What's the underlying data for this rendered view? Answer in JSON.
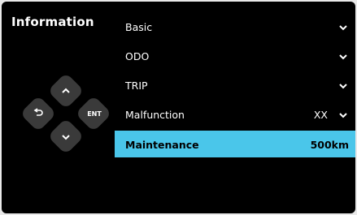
{
  "screen": {
    "title": "Information"
  },
  "menu": {
    "items": [
      {
        "label": "Basic",
        "value": "",
        "icon": "chevron-down-icon"
      },
      {
        "label": "ODO",
        "value": "",
        "icon": "chevron-down-icon"
      },
      {
        "label": "TRIP",
        "value": "",
        "icon": "chevron-down-icon"
      },
      {
        "label": "Malfunction",
        "value": "XX",
        "icon": "chevron-down-icon"
      },
      {
        "label": "Maintenance",
        "value": "500km",
        "icon": ""
      }
    ],
    "selected_index": 4
  },
  "controls": {
    "ent_label": "ENT",
    "icons": [
      "chevron-up-icon",
      "chevron-down-icon",
      "back-icon"
    ]
  },
  "colors": {
    "selected_bg": "#4ac6ea",
    "button_bg": "#3a3a3a",
    "screen_bg": "#000000"
  }
}
